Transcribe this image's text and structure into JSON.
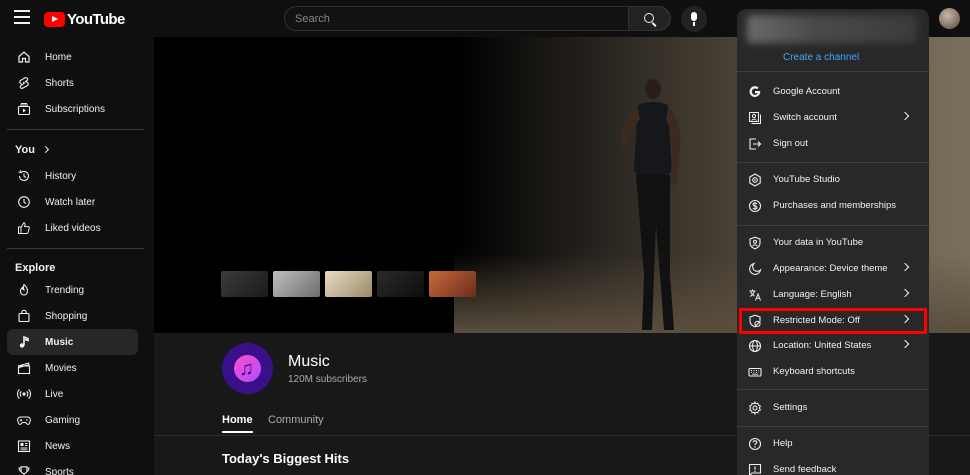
{
  "topbar": {
    "logo_text": "YouTube",
    "search_placeholder": "Search"
  },
  "sidebar": {
    "primary": [
      {
        "label": "Home",
        "icon": "home-icon"
      },
      {
        "label": "Shorts",
        "icon": "shorts-icon"
      },
      {
        "label": "Subscriptions",
        "icon": "subscriptions-icon"
      }
    ],
    "you_heading": "You",
    "you_items": [
      {
        "label": "History",
        "icon": "history-icon"
      },
      {
        "label": "Watch later",
        "icon": "clock-icon"
      },
      {
        "label": "Liked videos",
        "icon": "thumbs-up-icon"
      }
    ],
    "explore_heading": "Explore",
    "explore_items": [
      {
        "label": "Trending",
        "icon": "flame-icon"
      },
      {
        "label": "Shopping",
        "icon": "shopping-bag-icon"
      },
      {
        "label": "Music",
        "icon": "music-note-icon",
        "active": true
      },
      {
        "label": "Movies",
        "icon": "clapperboard-icon"
      },
      {
        "label": "Live",
        "icon": "live-icon"
      },
      {
        "label": "Gaming",
        "icon": "gamepad-icon"
      },
      {
        "label": "News",
        "icon": "newspaper-icon"
      },
      {
        "label": "Sports",
        "icon": "trophy-icon"
      }
    ]
  },
  "channel": {
    "name": "Music",
    "subscribers": "120M subscribers",
    "tabs": [
      "Home",
      "Community"
    ],
    "shelf_title": "Today's Biggest Hits"
  },
  "account_menu": {
    "create_channel": "Create a channel",
    "groups": [
      [
        {
          "label": "Google Account",
          "icon": "google-icon",
          "chevron": false
        },
        {
          "label": "Switch account",
          "icon": "switch-account-icon",
          "chevron": true
        },
        {
          "label": "Sign out",
          "icon": "sign-out-icon",
          "chevron": false
        }
      ],
      [
        {
          "label": "YouTube Studio",
          "icon": "studio-icon",
          "chevron": false
        },
        {
          "label": "Purchases and memberships",
          "icon": "dollar-icon",
          "chevron": false
        }
      ],
      [
        {
          "label": "Your data in YouTube",
          "icon": "shield-person-icon",
          "chevron": false
        },
        {
          "label": "Appearance: Device theme",
          "icon": "moon-icon",
          "chevron": true
        },
        {
          "label": "Language: English",
          "icon": "translate-icon",
          "chevron": true
        },
        {
          "label": "Restricted Mode: Off",
          "icon": "restricted-mode-icon",
          "chevron": true,
          "highlighted": true
        },
        {
          "label": "Location: United States",
          "icon": "globe-icon",
          "chevron": true
        },
        {
          "label": "Keyboard shortcuts",
          "icon": "keyboard-icon",
          "chevron": false
        }
      ],
      [
        {
          "label": "Settings",
          "icon": "gear-icon",
          "chevron": false
        }
      ],
      [
        {
          "label": "Help",
          "icon": "help-icon",
          "chevron": false
        },
        {
          "label": "Send feedback",
          "icon": "feedback-icon",
          "chevron": false
        }
      ]
    ]
  },
  "colors": {
    "brand_red": "#ff0000",
    "link_blue": "#3ea6ff",
    "highlight_outline": "#ff0000"
  }
}
